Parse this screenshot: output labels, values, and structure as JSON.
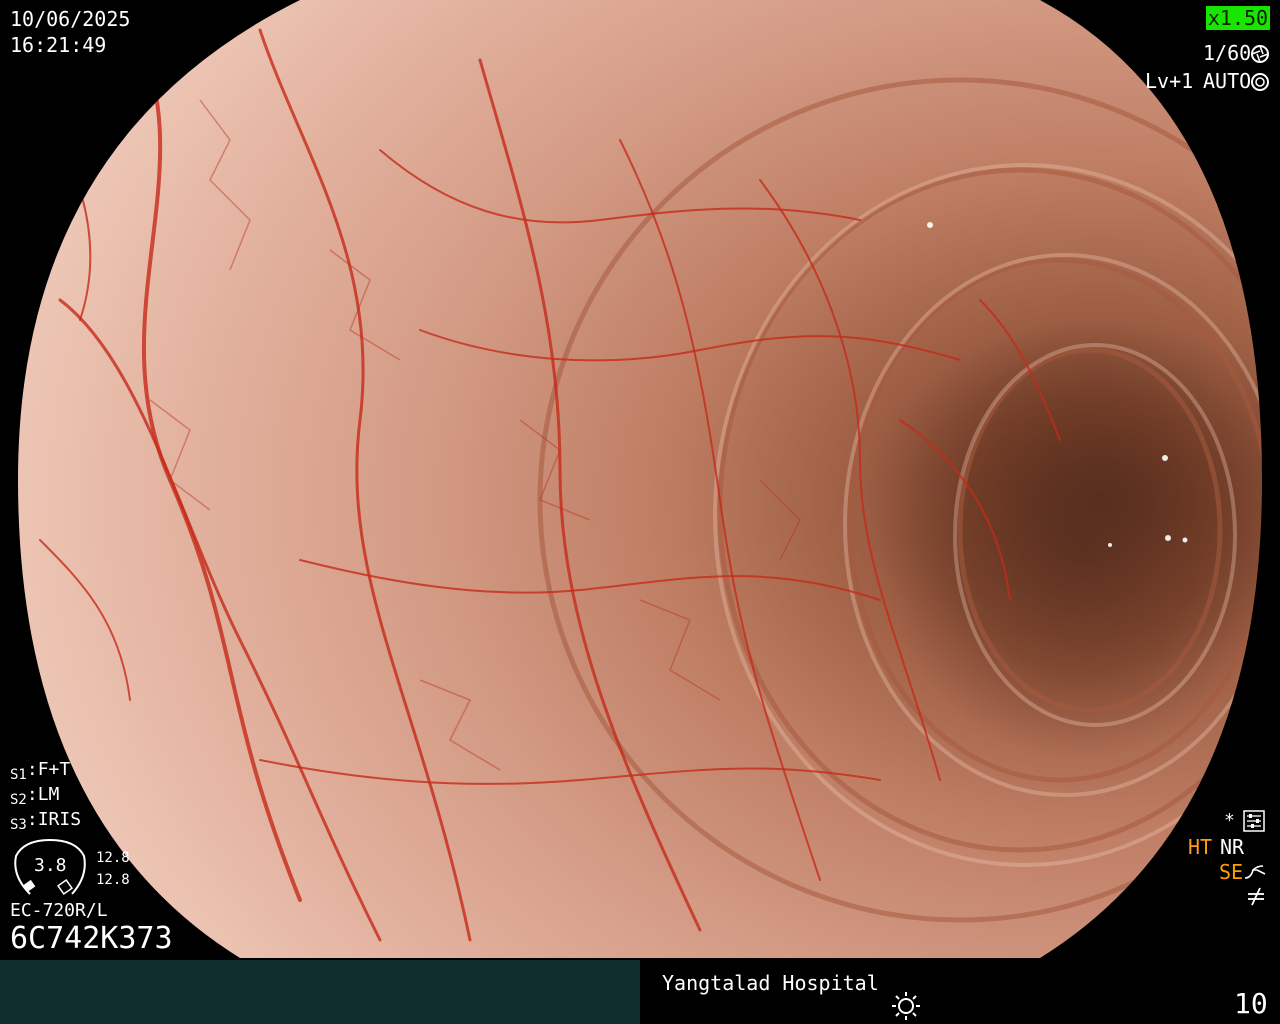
{
  "overlay": {
    "date": "10/06/2025",
    "time": "16:21:49",
    "zoom": "x1.50",
    "shutter": "1/60",
    "enhance_level": "Lv+1",
    "iris_mode": "AUTO",
    "switches": [
      {
        "key": "S1",
        "value": "F+T"
      },
      {
        "key": "S2",
        "value": "LM"
      },
      {
        "key": "S3",
        "value": "IRIS"
      }
    ],
    "scope_center_value": "3.8",
    "scope_val_top": "12.8",
    "scope_val_bottom": "12.8",
    "scope_model": "EC-720R/L",
    "scope_serial": "6C742K373",
    "right_status": {
      "star": "*",
      "ht": "HT",
      "nr": "NR",
      "se": "SE"
    },
    "colors": {
      "zoom_badge_bg": "#17e600",
      "ht": "#ff9a1a",
      "se": "#ffa000",
      "bottom_left_bar": "#0f2e2c"
    }
  },
  "bottom_bar": {
    "hospital": "Yangtalad Hospital",
    "counter": "10",
    "light_icon": "sun-icon"
  }
}
